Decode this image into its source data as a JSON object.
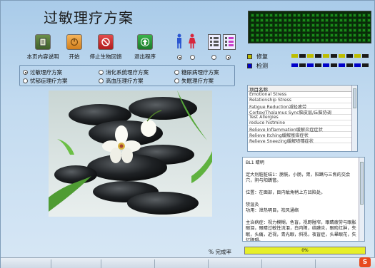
{
  "app": {
    "title": "过敏理疗方案"
  },
  "toolbar": {
    "doc_label": "本页内容说明",
    "start_label": "开始",
    "stop_label": "停止生物回馈",
    "exit_label": "退出程序"
  },
  "options": [
    {
      "label": "过敏理疗方案",
      "selected": true
    },
    {
      "label": "消化系统理疗方案",
      "selected": false
    },
    {
      "label": "糖尿病理疗方案",
      "selected": false
    },
    {
      "label": "忧郁症理疗方案",
      "selected": false
    },
    {
      "label": "高血压理疗方案",
      "selected": false
    },
    {
      "label": "失眠理疗方案",
      "selected": false
    }
  ],
  "status": {
    "repair_label": "修复",
    "detect_label": "检测",
    "repair_color": "#bdbd00",
    "detect_color": "#0000c8"
  },
  "list": {
    "header": "项目名称",
    "items": [
      "Emotional Stress",
      "Relationship Stress",
      "Fatigue Reduction减轻疲劳",
      "Cortex/Thalamus Sync脑皮层/丘脑协调",
      "Test Allergies",
      "reduce histmine",
      "Relieve Inflammation缓解炎症症状",
      "Relieve Itching缓解瘙痒症状",
      "Relieve Sneezing缓解喷嚏症状"
    ]
  },
  "description": {
    "text": "BL1 睛明\n\n定大别脏脏结1：膀胱，小肠，胃，阳蹻与三焦的交会穴，阴与阳蹻管。\n\n位置：在面部，目内眦角稍上方凹陷处。\n\n禁温灸\n功用：泄热明目，祛风通络\n\n主治病症：视力模糊，色盲，视野隘窄，眼睛疲劳与眼胀眼泪，眼睛过敏性流泪，白内障，结膜炎，眼睑红肿，失眠，头痛，近视，青光眼，斜视，夜盲症，头晕眼花，失忆障碍。\nBL1 Jing Ming\n\nBladder 1 The meeting point of the Bladder, Small Intestine,"
  },
  "progress": {
    "label": "% 完成率",
    "value": 0,
    "text": "0%"
  },
  "sogou_icon": "S"
}
